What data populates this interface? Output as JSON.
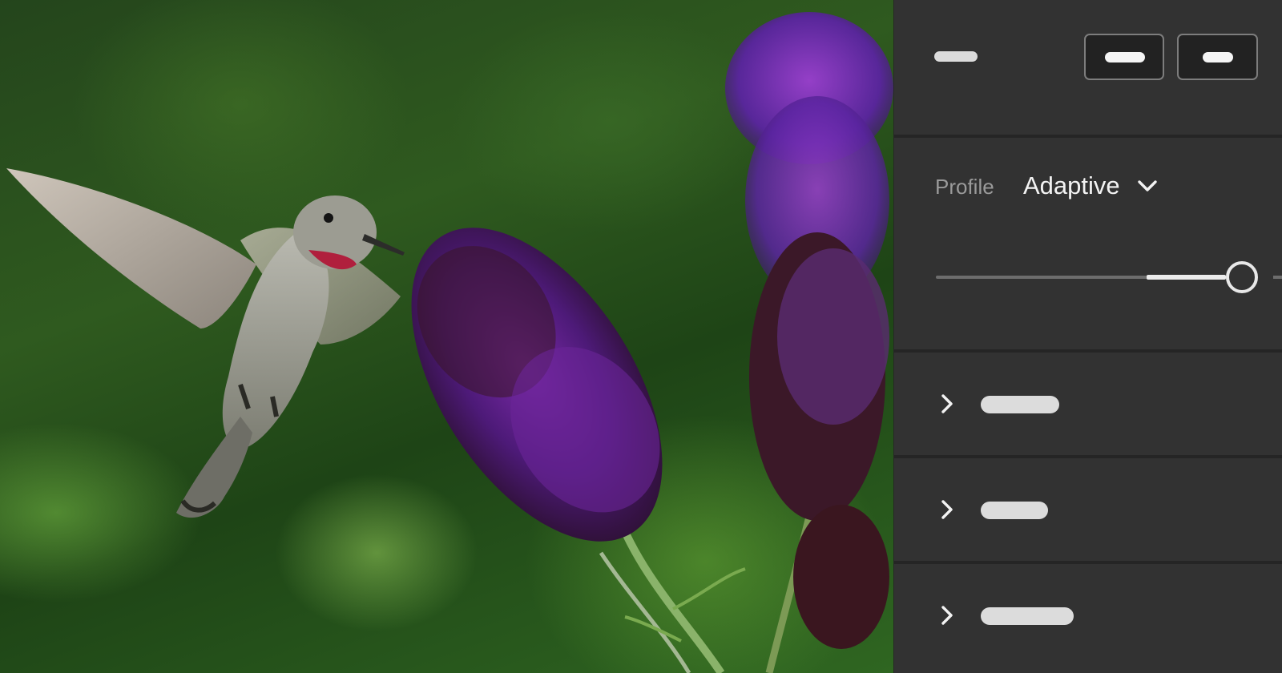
{
  "profile": {
    "label": "Profile",
    "value": "Adaptive",
    "amount_percent": 92
  },
  "icons": {
    "dropdown": "chevron-down-icon",
    "expand": "chevron-right-icon"
  },
  "colors": {
    "panel_bg": "#323232",
    "panel_divider": "#252525",
    "text_primary": "#f3f3f3",
    "text_muted": "#9a9a9a"
  }
}
